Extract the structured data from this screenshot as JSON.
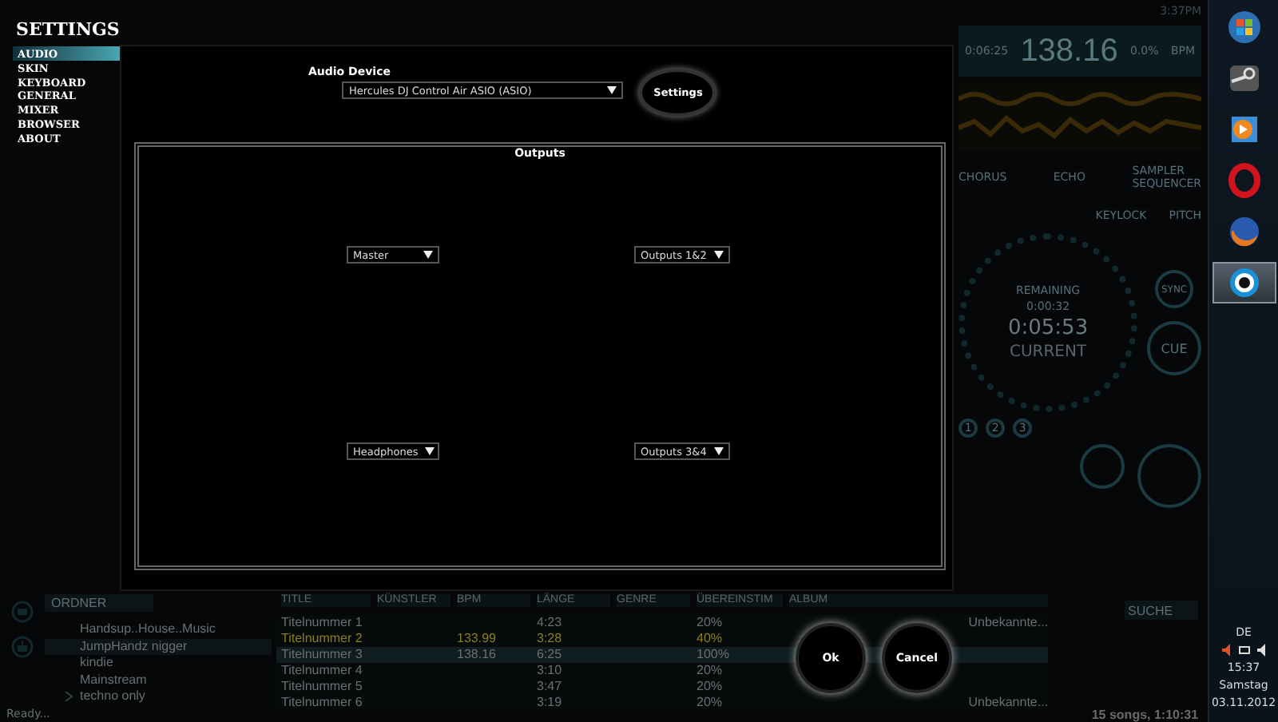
{
  "settings": {
    "title": "SETTINGS",
    "menu": [
      {
        "label": "AUDIO",
        "selected": true
      },
      {
        "label": "SKIN",
        "selected": false
      },
      {
        "label": "KEYBOARD",
        "selected": false
      },
      {
        "label": "GENERAL",
        "selected": false
      },
      {
        "label": "MIXER",
        "selected": false
      },
      {
        "label": "BROWSER",
        "selected": false
      },
      {
        "label": "ABOUT",
        "selected": false
      }
    ]
  },
  "dialog": {
    "audio_device_label": "Audio Device",
    "audio_device": "Hercules DJ Control Air ASIO (ASIO)",
    "settings_button": "Settings",
    "outputs_title": "Outputs",
    "outputs": [
      {
        "channel": "Master",
        "route": "Outputs 1&2"
      },
      {
        "channel": "Headphones",
        "route": "Outputs 3&4"
      }
    ],
    "buttons": [
      "Ok",
      "Cancel"
    ]
  },
  "deck": {
    "clock": "3:37PM",
    "elapsed": "0:06:25",
    "bpm": "138.16",
    "pitch_percent": "0.0%",
    "bpm_unit": "BPM",
    "effects": [
      "CHORUS",
      "ECHO"
    ],
    "sampler": "SAMPLER",
    "sequencer": "SEQUENCER",
    "keylock": "KEYLOCK",
    "pitch": "PITCH",
    "remaining_label": "REMAINING",
    "remaining": "0:00:32",
    "current": "0:05:53",
    "current_label": "CURRENT",
    "hot_cues": [
      "1",
      "2",
      "3"
    ],
    "sync": "SYNC",
    "cue": "CUE"
  },
  "browser": {
    "folders_title": "ORDNER",
    "folders": [
      {
        "label": "Handsup..House..Music",
        "selected": false,
        "expandable": false
      },
      {
        "label": "JumpHandz nigger",
        "selected": true,
        "expandable": false
      },
      {
        "label": "kindie",
        "selected": false,
        "expandable": false
      },
      {
        "label": "Mainstream",
        "selected": false,
        "expandable": false
      },
      {
        "label": "techno only",
        "selected": false,
        "expandable": true
      }
    ],
    "columns": [
      "TITLE",
      "KÜNSTLER",
      "BPM",
      "LÄNGE",
      "GENRE",
      "ÜBEREINSTIM",
      "ALBUM"
    ],
    "rows": [
      {
        "title": "Titelnummer 1",
        "bpm": "",
        "length": "4:23",
        "match": "20%",
        "album": "Unbekannte...",
        "loaded": false,
        "selected": false
      },
      {
        "title": "Titelnummer 2",
        "bpm": "133.99",
        "length": "3:28",
        "match": "40%",
        "album": "",
        "loaded": true,
        "selected": false
      },
      {
        "title": "Titelnummer 3",
        "bpm": "138.16",
        "length": "6:25",
        "match": "100%",
        "album": "",
        "loaded": false,
        "selected": true
      },
      {
        "title": "Titelnummer 4",
        "bpm": "",
        "length": "3:10",
        "match": "20%",
        "album": "",
        "loaded": false,
        "selected": false
      },
      {
        "title": "Titelnummer 5",
        "bpm": "",
        "length": "3:47",
        "match": "20%",
        "album": "",
        "loaded": false,
        "selected": false
      },
      {
        "title": "Titelnummer 6",
        "bpm": "",
        "length": "3:19",
        "match": "20%",
        "album": "Unbekannte...",
        "loaded": false,
        "selected": false
      }
    ],
    "search": {
      "placeholder": "SUCHE"
    },
    "status": "Ready...",
    "summary": "15 songs, 1:10:31"
  },
  "taskbar": {
    "apps": [
      {
        "kind": "start",
        "selected": false
      },
      {
        "kind": "steam",
        "selected": false
      },
      {
        "kind": "player",
        "selected": false
      },
      {
        "kind": "opera",
        "selected": false
      },
      {
        "kind": "firefox",
        "selected": false
      },
      {
        "kind": "djuced",
        "selected": true
      }
    ],
    "language": "DE",
    "time": "15:37",
    "day": "Samstag",
    "date": "03.11.2012"
  }
}
